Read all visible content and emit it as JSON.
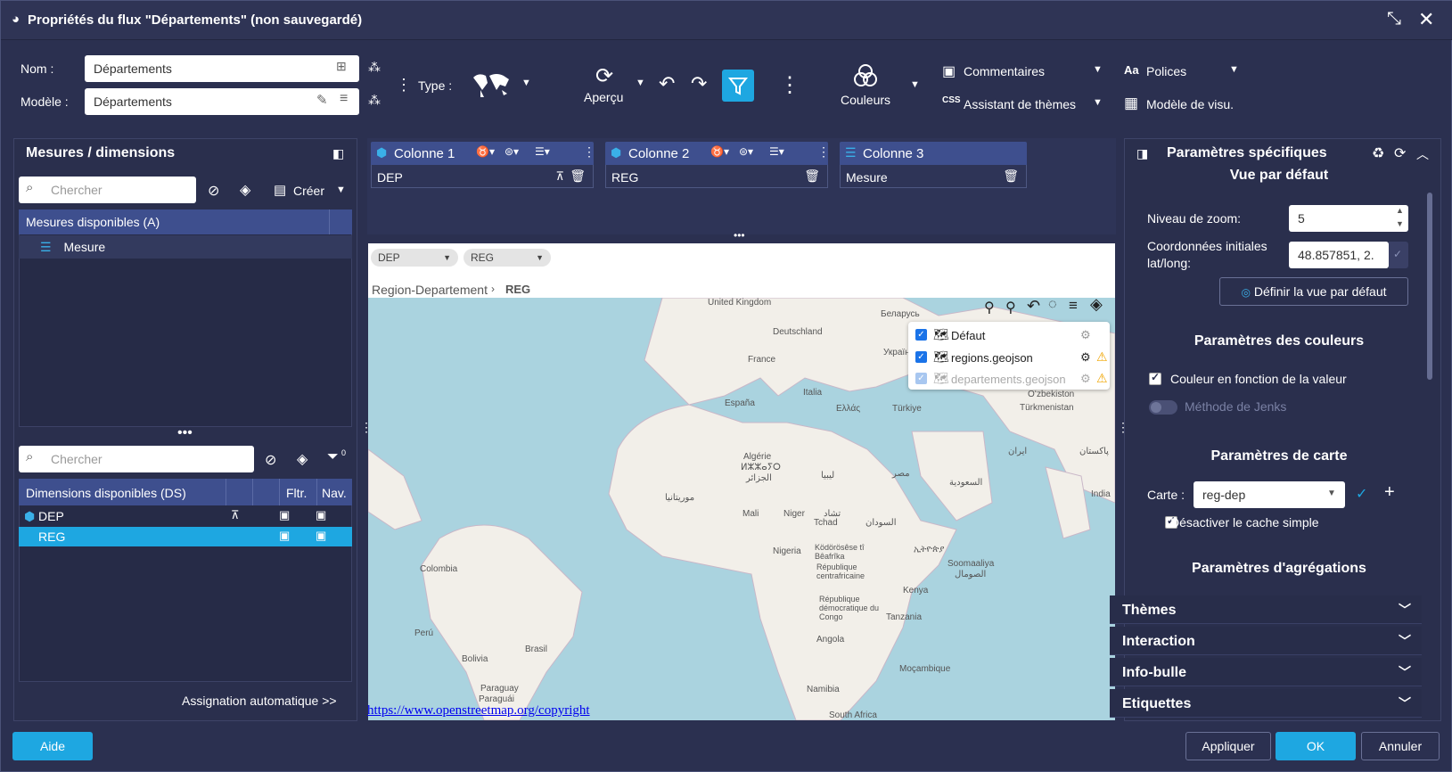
{
  "window": {
    "title": "Propriétés du flux \"Départements\" (non sauvegardé)"
  },
  "header": {
    "nom_label": "Nom :",
    "nom_value": "Départements",
    "modele_label": "Modèle :",
    "modele_value": "Départements",
    "type_label": "Type :",
    "apercu_label": "Aperçu",
    "couleurs_label": "Couleurs",
    "commentaires_label": "Commentaires",
    "assistant_label": "Assistant de thèmes",
    "polices_label": "Polices",
    "modele_visu_label": "Modèle de visu."
  },
  "left": {
    "title": "Mesures / dimensions",
    "search_placeholder": "Chercher",
    "create_label": "Créer",
    "measures_header": "Mesures disponibles (A)",
    "measures": [
      "Mesure"
    ],
    "search2_placeholder": "Chercher",
    "filter_count": "0",
    "dims_header": "Dimensions disponibles (DS)",
    "col_fltr": "Fltr.",
    "col_nav": "Nav.",
    "dims": [
      "DEP",
      "REG"
    ],
    "auto_assign": "Assignation automatique >>"
  },
  "columns": [
    {
      "title": "Colonne 1",
      "value": "DEP"
    },
    {
      "title": "Colonne 2",
      "value": "REG"
    },
    {
      "title": "Colonne 3",
      "value": "Mesure"
    }
  ],
  "preview": {
    "chip1": "DEP",
    "chip2": "REG",
    "breadcrumb_1": "Region-Departement",
    "breadcrumb_2": "REG",
    "layers": [
      "Défaut",
      "regions.geojson",
      "departements.geojson"
    ],
    "copyright": "https://www.openstreetmap.org/copyright",
    "map_labels": [
      "United Kingdom",
      "Deutschland",
      "France",
      "Беларусь",
      "Україна",
      "España",
      "Italia",
      "Ελλάς",
      "Türkiye",
      "Oʻzbekiston",
      "Türkmenistan",
      "Algérie",
      "ⵍⵣⵣⴰⵢⵔ",
      "الجزائر",
      "ليبيا",
      "مصر",
      "ايران",
      "پاکستان",
      "موريتانيا",
      "Mali",
      "Niger",
      "Tchad",
      "تشاد",
      "السودان",
      "السعودية",
      "India",
      "Nigeria",
      "Ködörösêse tî Bêafrîka",
      "République centrafricaine",
      "ኢትዮጵያ",
      "Soomaaliya",
      "الصومال",
      "Kenya",
      "Tanzania",
      "République démocratique du Congo",
      "Colombia",
      "Perú",
      "Brasil",
      "Bolivia",
      "Angola",
      "Moçambique",
      "Namibia",
      "Paraguay",
      "Paraguái",
      "South Africa"
    ]
  },
  "right": {
    "title": "Paramètres spécifiques",
    "vue_title": "Vue par défaut",
    "zoom_label": "Niveau de zoom:",
    "zoom_value": "5",
    "coords_label_1": "Coordonnées initiales",
    "coords_label_2": "lat/long:",
    "coords_value": "48.857851, 2.",
    "define_view": "Définir la vue par défaut",
    "colors_title": "Paramètres des couleurs",
    "color_by_value": "Couleur en fonction de la valeur",
    "jenks": "Méthode de Jenks",
    "map_title": "Paramètres de carte",
    "carte_label": "Carte :",
    "carte_value": "reg-dep",
    "disable_cache": "Désactiver le cache simple",
    "agg_title": "Paramètres d'agrégations",
    "accordions": [
      "Thèmes",
      "Interaction",
      "Info-bulle",
      "Etiquettes"
    ]
  },
  "footer": {
    "aide": "Aide",
    "appliquer": "Appliquer",
    "ok": "OK",
    "annuler": "Annuler"
  },
  "colors": {
    "accent": "#1ea7e1",
    "bg": "#2b3050",
    "selected_row": "#1ea7e1",
    "header_row": "#3e4f8e"
  }
}
